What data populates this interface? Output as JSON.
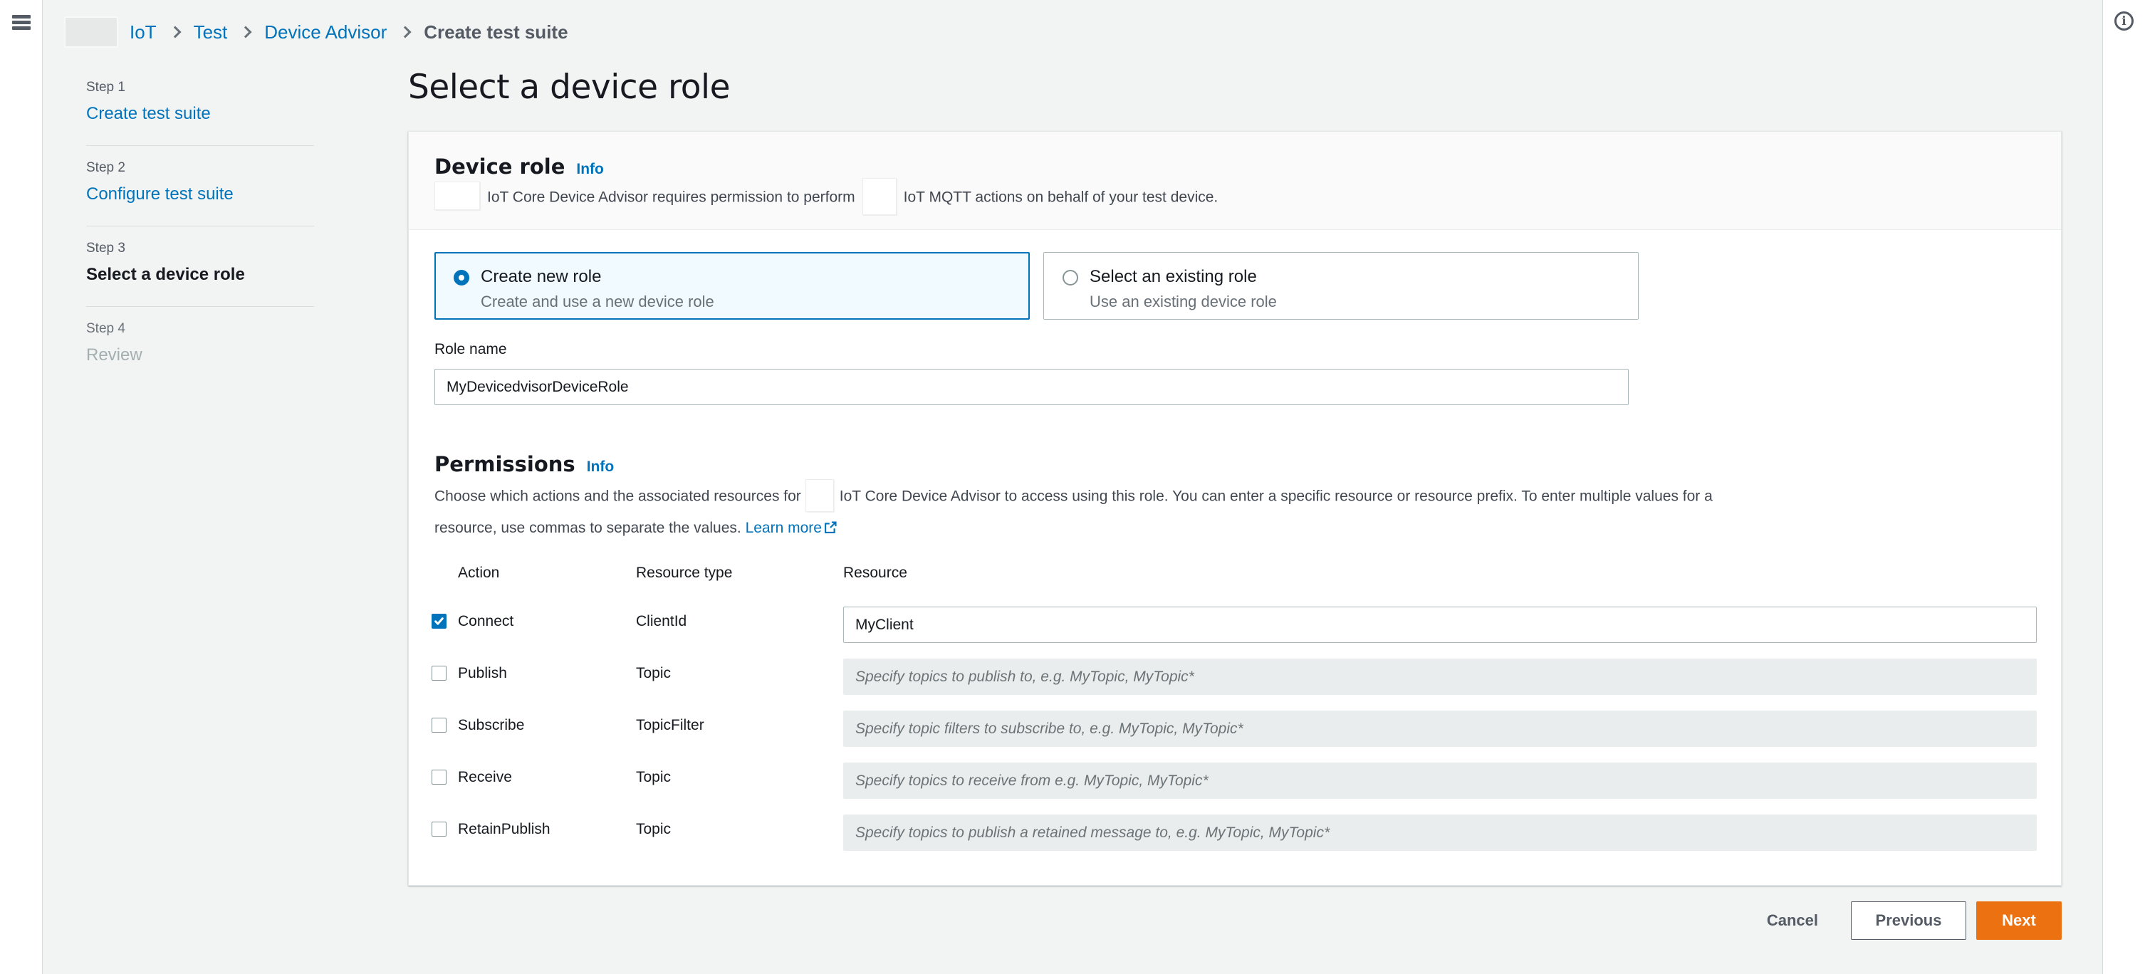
{
  "breadcrumb": {
    "items": [
      {
        "label": "IoT",
        "type": "link"
      },
      {
        "label": "Test",
        "type": "link"
      },
      {
        "label": "Device Advisor",
        "type": "link"
      },
      {
        "label": "Create test suite",
        "type": "current"
      }
    ]
  },
  "side_nav": {
    "steps": [
      {
        "step": "Step 1",
        "label": "Create test suite",
        "state": "link"
      },
      {
        "step": "Step 2",
        "label": "Configure test suite",
        "state": "link"
      },
      {
        "step": "Step 3",
        "label": "Select a device role",
        "state": "current"
      },
      {
        "step": "Step 4",
        "label": "Review",
        "state": "disabled"
      }
    ]
  },
  "page": {
    "title": "Select a device role"
  },
  "device_role": {
    "heading": "Device role",
    "info_label": "Info",
    "desc_part1": "IoT Core Device Advisor requires permission to perform",
    "desc_part2": "IoT MQTT actions on behalf of your test device."
  },
  "role_options": [
    {
      "label": "Create new role",
      "desc": "Create and use a new device role",
      "selected": true
    },
    {
      "label": "Select an existing role",
      "desc": "Use an existing device role",
      "selected": false
    }
  ],
  "role_name": {
    "label": "Role name",
    "value": "MyDevicedvisorDeviceRole"
  },
  "permissions": {
    "heading": "Permissions",
    "info_label": "Info",
    "desc_line1_a": "Choose which actions and the associated resources for",
    "desc_line1_b": "IoT Core Device Advisor to access using this role. You can enter a specific resource or resource prefix. To enter multiple values for a",
    "desc_line2": "resource, use commas to separate the values.",
    "learn_more_label": "Learn more",
    "columns": {
      "action": "Action",
      "resource_type": "Resource type",
      "resource": "Resource"
    },
    "rows": [
      {
        "action": "Connect",
        "resource_type": "ClientId",
        "checked": true,
        "value": "MyClient",
        "placeholder": ""
      },
      {
        "action": "Publish",
        "resource_type": "Topic",
        "checked": false,
        "value": "",
        "placeholder": "Specify topics to publish to, e.g. MyTopic, MyTopic*"
      },
      {
        "action": "Subscribe",
        "resource_type": "TopicFilter",
        "checked": false,
        "value": "",
        "placeholder": "Specify topic filters to subscribe to, e.g. MyTopic, MyTopic*"
      },
      {
        "action": "Receive",
        "resource_type": "Topic",
        "checked": false,
        "value": "",
        "placeholder": "Specify topics to receive from e.g. MyTopic, MyTopic*"
      },
      {
        "action": "RetainPublish",
        "resource_type": "Topic",
        "checked": false,
        "value": "",
        "placeholder": "Specify topics to publish a retained message to, e.g. MyTopic, MyTopic*"
      }
    ]
  },
  "footer": {
    "cancel_label": "Cancel",
    "previous_label": "Previous",
    "next_label": "Next"
  },
  "colors": {
    "accent_orange": "#ec7211",
    "link_blue": "#0073bb",
    "selected_tile_bg": "#f1faff",
    "page_bg": "#f2f3f3",
    "text_primary": "#16191f",
    "text_secondary": "#687078",
    "disabled_input_bg": "#eaeded"
  }
}
